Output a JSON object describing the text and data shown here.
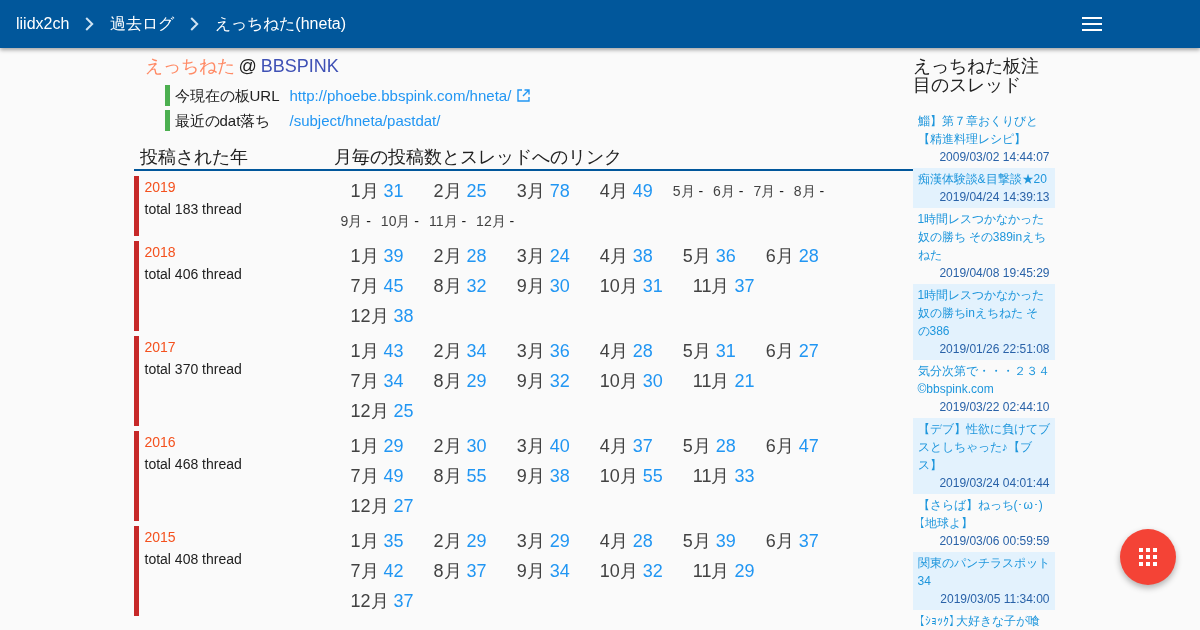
{
  "breadcrumb": [
    {
      "label": "liidx2ch"
    },
    {
      "label": "過去ログ"
    },
    {
      "label": "えっちねた(hneta)"
    }
  ],
  "board": {
    "name": "えっちねた",
    "separator": "@",
    "site": "BBSPINK"
  },
  "info": [
    {
      "label": "今現在の板URL",
      "link": "http://phoebe.bbspink.com/hneta/",
      "external": true
    },
    {
      "label": "最近のdat落ち",
      "link": "/subject/hneta/pastdat/",
      "external": false
    }
  ],
  "table": {
    "columns": [
      "投稿された年",
      "月毎の投稿数とスレッドへのリンク"
    ],
    "rows": [
      {
        "year": "2019",
        "total": "total 183 thread",
        "months": [
          {
            "month": "1月",
            "count": "31",
            "kind": "posts"
          },
          {
            "month": "2月",
            "count": "25",
            "kind": "posts"
          },
          {
            "month": "3月",
            "count": "78",
            "kind": "posts"
          },
          {
            "month": "4月",
            "count": "49",
            "kind": "posts"
          },
          {
            "month": "5月",
            "count": "-",
            "kind": "empty"
          },
          {
            "month": "6月",
            "count": "-",
            "kind": "empty"
          },
          {
            "month": "7月",
            "count": "-",
            "kind": "empty"
          },
          {
            "month": "8月",
            "count": "-",
            "kind": "empty"
          },
          {
            "month": "9月",
            "count": "-",
            "kind": "empty"
          },
          {
            "month": "10月",
            "count": "-",
            "kind": "empty"
          },
          {
            "month": "11月",
            "count": "-",
            "kind": "empty"
          },
          {
            "month": "12月",
            "count": "-",
            "kind": "empty"
          }
        ]
      },
      {
        "year": "2018",
        "total": "total 406 thread",
        "months": [
          {
            "month": "1月",
            "count": "39",
            "kind": "posts"
          },
          {
            "month": "2月",
            "count": "28",
            "kind": "posts"
          },
          {
            "month": "3月",
            "count": "24",
            "kind": "posts"
          },
          {
            "month": "4月",
            "count": "38",
            "kind": "posts"
          },
          {
            "month": "5月",
            "count": "36",
            "kind": "posts"
          },
          {
            "month": "6月",
            "count": "28",
            "kind": "posts"
          },
          {
            "month": "7月",
            "count": "45",
            "kind": "posts"
          },
          {
            "month": "8月",
            "count": "32",
            "kind": "posts"
          },
          {
            "month": "9月",
            "count": "30",
            "kind": "posts"
          },
          {
            "month": "10月",
            "count": "31",
            "kind": "posts"
          },
          {
            "month": "11月",
            "count": "37",
            "kind": "posts"
          },
          {
            "month": "12月",
            "count": "38",
            "kind": "posts"
          }
        ]
      },
      {
        "year": "2017",
        "total": "total 370 thread",
        "months": [
          {
            "month": "1月",
            "count": "43",
            "kind": "posts"
          },
          {
            "month": "2月",
            "count": "34",
            "kind": "posts"
          },
          {
            "month": "3月",
            "count": "36",
            "kind": "posts"
          },
          {
            "month": "4月",
            "count": "28",
            "kind": "posts"
          },
          {
            "month": "5月",
            "count": "31",
            "kind": "posts"
          },
          {
            "month": "6月",
            "count": "27",
            "kind": "posts"
          },
          {
            "month": "7月",
            "count": "34",
            "kind": "posts"
          },
          {
            "month": "8月",
            "count": "29",
            "kind": "posts"
          },
          {
            "month": "9月",
            "count": "32",
            "kind": "posts"
          },
          {
            "month": "10月",
            "count": "30",
            "kind": "posts"
          },
          {
            "month": "11月",
            "count": "21",
            "kind": "posts"
          },
          {
            "month": "12月",
            "count": "25",
            "kind": "posts"
          }
        ]
      },
      {
        "year": "2016",
        "total": "total 468 thread",
        "months": [
          {
            "month": "1月",
            "count": "29",
            "kind": "posts"
          },
          {
            "month": "2月",
            "count": "30",
            "kind": "posts"
          },
          {
            "month": "3月",
            "count": "40",
            "kind": "posts"
          },
          {
            "month": "4月",
            "count": "37",
            "kind": "posts"
          },
          {
            "month": "5月",
            "count": "28",
            "kind": "posts"
          },
          {
            "month": "6月",
            "count": "47",
            "kind": "posts"
          },
          {
            "month": "7月",
            "count": "49",
            "kind": "posts"
          },
          {
            "month": "8月",
            "count": "55",
            "kind": "posts"
          },
          {
            "month": "9月",
            "count": "38",
            "kind": "posts"
          },
          {
            "month": "10月",
            "count": "55",
            "kind": "posts"
          },
          {
            "month": "11月",
            "count": "33",
            "kind": "posts"
          },
          {
            "month": "12月",
            "count": "27",
            "kind": "posts"
          }
        ]
      },
      {
        "year": "2015",
        "total": "total 408 thread",
        "months": [
          {
            "month": "1月",
            "count": "35",
            "kind": "posts"
          },
          {
            "month": "2月",
            "count": "29",
            "kind": "posts"
          },
          {
            "month": "3月",
            "count": "29",
            "kind": "posts"
          },
          {
            "month": "4月",
            "count": "28",
            "kind": "posts"
          },
          {
            "month": "5月",
            "count": "39",
            "kind": "posts"
          },
          {
            "month": "6月",
            "count": "37",
            "kind": "posts"
          },
          {
            "month": "7月",
            "count": "42",
            "kind": "posts"
          },
          {
            "month": "8月",
            "count": "37",
            "kind": "posts"
          },
          {
            "month": "9月",
            "count": "34",
            "kind": "posts"
          },
          {
            "month": "10月",
            "count": "32",
            "kind": "posts"
          },
          {
            "month": "11月",
            "count": "29",
            "kind": "posts"
          },
          {
            "month": "12月",
            "count": "37",
            "kind": "posts"
          }
        ]
      }
    ]
  },
  "sidebar": {
    "title": "えっちねた板注目のスレッド",
    "threads": [
      {
        "title": "鯔】第７章おくりびと【精進料理レシピ】",
        "date": "2009/03/02 14:44:07"
      },
      {
        "title": "痴漢体験談&目撃談★20",
        "date": "2019/04/24 14:39:13"
      },
      {
        "title": "1時間レスつかなかった奴の勝ち その389inえちねた",
        "date": "2019/04/08 19:45:29"
      },
      {
        "title": "1時間レスつかなかった奴の勝ちinえちねた その386",
        "date": "2019/01/26 22:51:08"
      },
      {
        "title": "気分次第で・・・２３４©bbspink.com",
        "date": "2019/03/22 02:44:10"
      },
      {
        "title": "【デブ】性欲に負けてブスとしちゃった♪【ブス】",
        "date": "2019/03/24 04:01:44"
      },
      {
        "title": "【さらば】ねっち(･ω･)【地球よ】",
        "date": "2019/03/06 00:59:59"
      },
      {
        "title": "関東のパンチラスポット34",
        "date": "2019/03/05 11:34:00"
      },
      {
        "title": "【ｼｮｯｸ】大好きな子が喰"
      }
    ]
  }
}
